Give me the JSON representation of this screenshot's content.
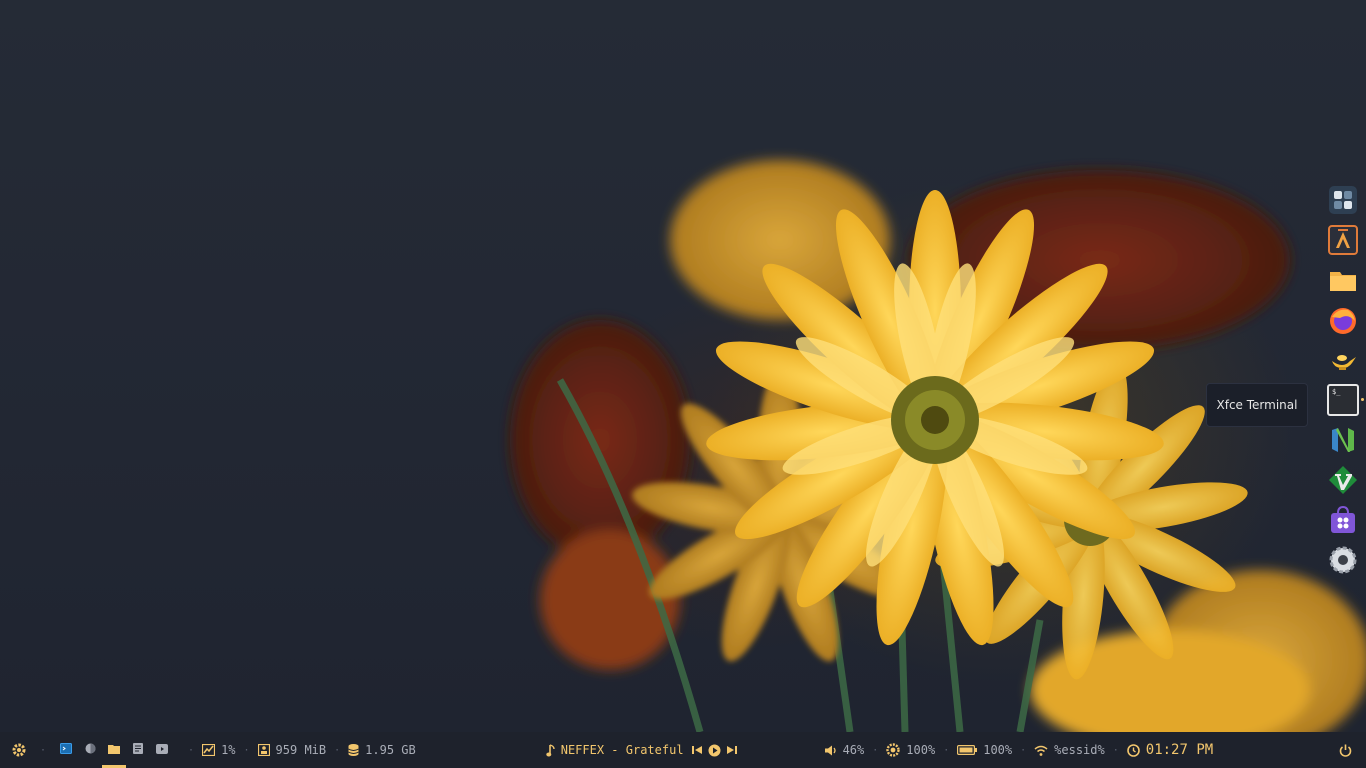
{
  "desktop": {
    "wallpaper": "yellow-flowers-dark-background"
  },
  "dock": {
    "items": [
      {
        "name": "app-launcher",
        "icon": "grid-icon"
      },
      {
        "name": "alacritty",
        "icon": "alacritty-icon"
      },
      {
        "name": "file-manager",
        "icon": "folder-icon"
      },
      {
        "name": "firefox",
        "icon": "firefox-icon"
      },
      {
        "name": "genie",
        "icon": "lamp-icon"
      },
      {
        "name": "xfce-terminal",
        "icon": "terminal-icon",
        "active": true
      },
      {
        "name": "neovim",
        "icon": "neovim-icon"
      },
      {
        "name": "vim",
        "icon": "vim-icon"
      },
      {
        "name": "software-store",
        "icon": "store-icon"
      },
      {
        "name": "settings",
        "icon": "gear-icon"
      }
    ],
    "tooltip": "Xfce Terminal"
  },
  "panel": {
    "cpu": "1%",
    "memory": "959 MiB",
    "disk": "1.95 GB",
    "music": "NEFFEX - Grateful",
    "volume": "46%",
    "brightness": "100%",
    "battery": "100%",
    "network": "%essid%",
    "clock": "01:27 PM",
    "workspaces": [
      {
        "icon": "terminal-icon",
        "active": false
      },
      {
        "icon": "browser-icon",
        "active": false
      },
      {
        "icon": "folder-icon",
        "active": true
      },
      {
        "icon": "notes-icon",
        "active": false
      },
      {
        "icon": "media-icon",
        "active": false
      }
    ],
    "colors": {
      "accent": "#f2c66d",
      "text": "#a9adb7",
      "bg": "#1e222c"
    }
  }
}
